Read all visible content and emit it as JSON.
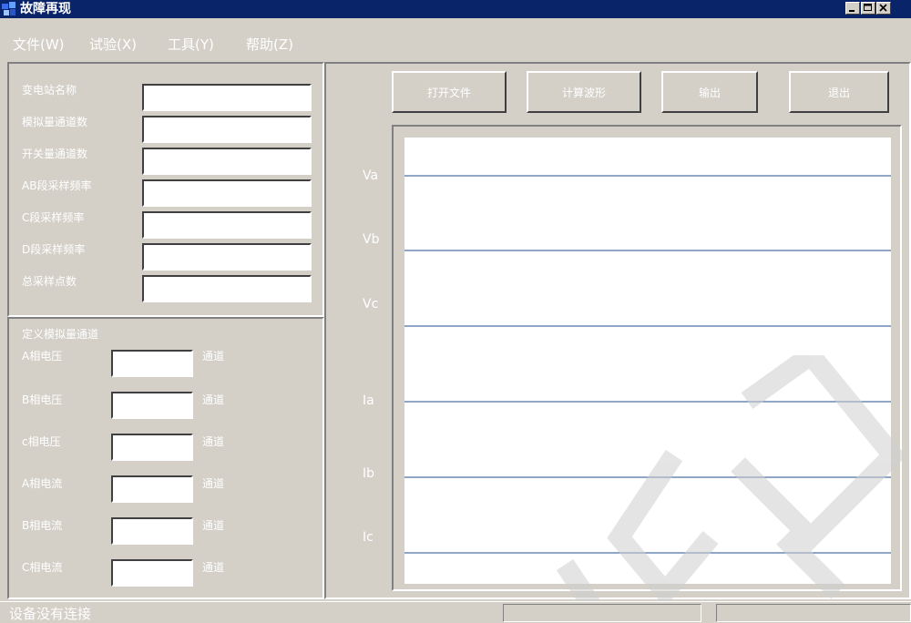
{
  "window": {
    "title": "故障再现"
  },
  "menu": [
    {
      "label": "文件(W)"
    },
    {
      "label": "试验(X)"
    },
    {
      "label": "工具(Y)"
    },
    {
      "label": "帮助(Z)"
    }
  ],
  "info": {
    "fields": [
      {
        "label": "变电站名称",
        "value": ""
      },
      {
        "label": "模拟量通道数",
        "value": ""
      },
      {
        "label": "开关量通道数",
        "value": ""
      },
      {
        "label": "AB段采样频率",
        "value": ""
      },
      {
        "label": "C段采样频率",
        "value": ""
      },
      {
        "label": "D段采样频率",
        "value": ""
      },
      {
        "label": "总采样点数",
        "value": ""
      }
    ]
  },
  "channels": {
    "title": "定义模拟量通道",
    "suffix": "通道",
    "rows": [
      {
        "label": "A相电压",
        "value": ""
      },
      {
        "label": "B相电压",
        "value": ""
      },
      {
        "label": "c相电压",
        "value": ""
      },
      {
        "label": "A相电流",
        "value": ""
      },
      {
        "label": "B相电流",
        "value": ""
      },
      {
        "label": "C相电流",
        "value": ""
      }
    ]
  },
  "toolbar": {
    "open_label": "打开文件",
    "calc_label": "计算波形",
    "output_label": "输出",
    "exit_label": "退出"
  },
  "waveform": {
    "labels": [
      "Va",
      "Vb",
      "Vc",
      "Ia",
      "Ib",
      "Ic"
    ],
    "line_color": "#1f4e8c"
  },
  "status": {
    "text": "设备没有连接"
  }
}
